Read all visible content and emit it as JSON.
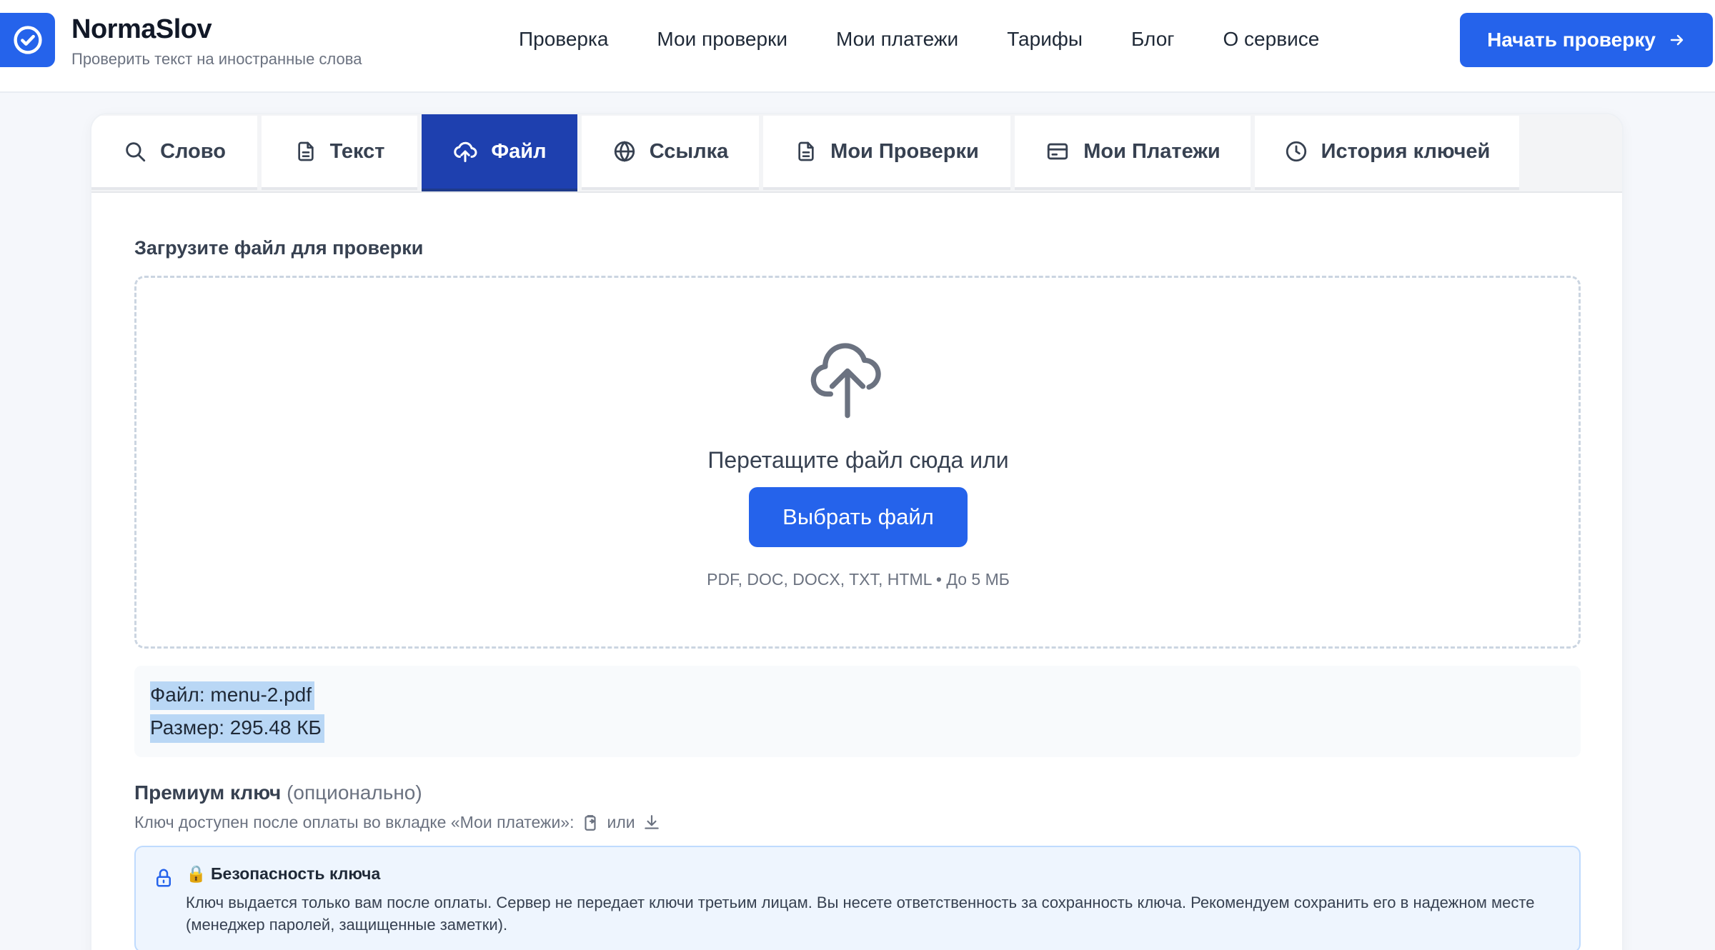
{
  "brand": {
    "name": "NormaSlov",
    "subtitle": "Проверить текст на иностранные слова",
    "accent": "#2563eb"
  },
  "nav": {
    "items": [
      "Проверка",
      "Мои проверки",
      "Мои платежи",
      "Тарифы",
      "Блог",
      "О сервисе"
    ],
    "cta_label": "Начать проверку",
    "cta_icon": "arrow-right-icon"
  },
  "tabs": [
    {
      "label": "Слово",
      "icon": "search-icon",
      "active": false
    },
    {
      "label": "Текст",
      "icon": "document-icon",
      "active": false
    },
    {
      "label": "Файл",
      "icon": "cloud-upload-icon",
      "active": true
    },
    {
      "label": "Ссылка",
      "icon": "globe-icon",
      "active": false
    },
    {
      "label": "Мои Проверки",
      "icon": "document-icon",
      "active": false
    },
    {
      "label": "Мои Платежи",
      "icon": "credit-card-icon",
      "active": false
    },
    {
      "label": "История ключей",
      "icon": "clock-icon",
      "active": false
    }
  ],
  "upload": {
    "section_label": "Загрузите файл для проверки",
    "drop_text": "Перетащите файл сюда или",
    "choose_button": "Выбрать файл",
    "formats": "PDF, DOC, DOCX, TXT, HTML • До 5 МБ"
  },
  "file_info": {
    "name_line": "Файл: menu-2.pdf",
    "size_line": "Размер: 295.48 КБ"
  },
  "premium": {
    "label": "Премиум ключ",
    "optional": "(опционально)",
    "hint": "Ключ доступен после оплаты во вкладке «Мои платежи»:",
    "hint_or": "или"
  },
  "security": {
    "title": "🔒 Безопасность ключа",
    "text": "Ключ выдается только вам после оплаты. Сервер не передает ключи третьим лицам. Вы несете ответственность за сохранность ключа. Рекомендуем сохранить его в надежном месте (менеджер паролей, защищенные заметки)."
  }
}
